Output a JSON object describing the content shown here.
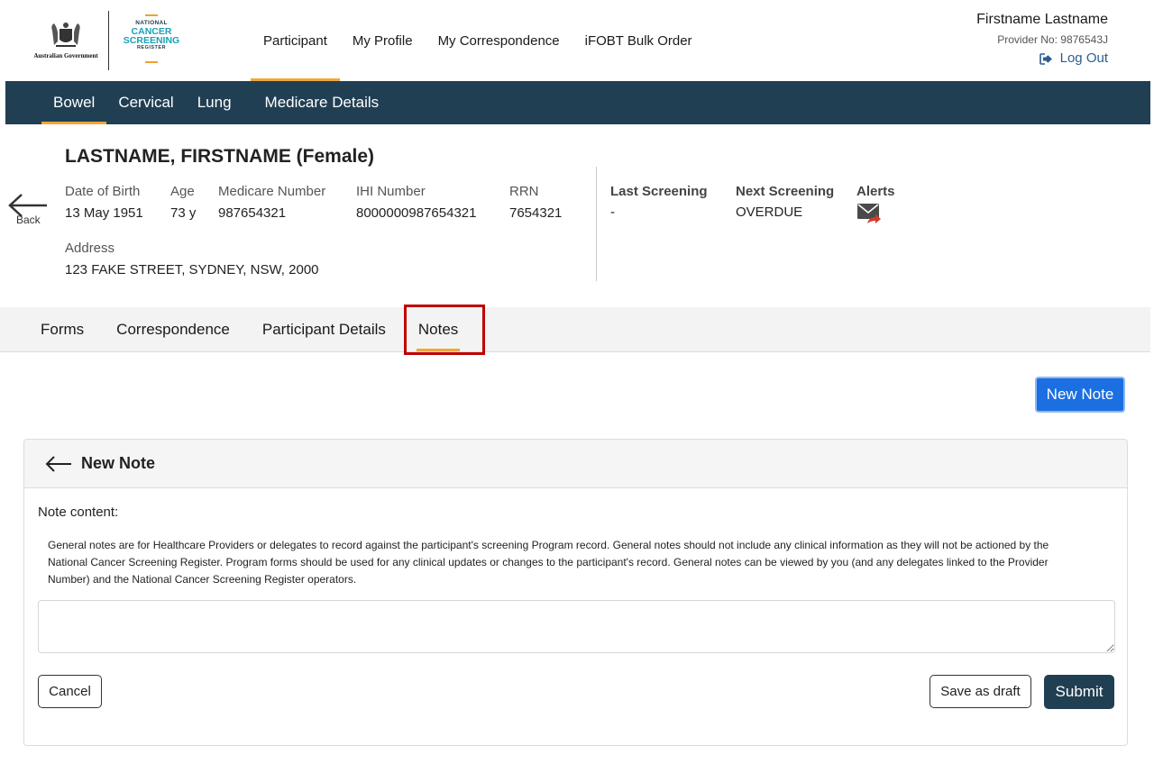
{
  "header": {
    "gov_logo_text": "Australian Government",
    "ncsr_logo": {
      "line1": "NATIONAL",
      "line2": "CANCER",
      "line3": "SCREENING",
      "line4": "REGISTER"
    },
    "nav": [
      {
        "label": "Participant",
        "active": true
      },
      {
        "label": "My Profile"
      },
      {
        "label": "My Correspondence"
      },
      {
        "label": "iFOBT Bulk Order"
      }
    ],
    "user": {
      "name": "Firstname Lastname",
      "provider_no": "Provider No: 9876543J",
      "logout_label": "Log Out"
    }
  },
  "subnav": [
    {
      "label": "Bowel",
      "active": true
    },
    {
      "label": "Cervical"
    },
    {
      "label": "Lung"
    },
    {
      "label": "Medicare Details"
    }
  ],
  "participant": {
    "back_label": "Back",
    "name": "LASTNAME, FIRSTNAME (Female)",
    "dob_label": "Date of Birth",
    "dob": "13 May 1951",
    "age_label": "Age",
    "age": "73 y",
    "medicare_label": "Medicare Number",
    "medicare": "987654321",
    "ihi_label": "IHI Number",
    "ihi": "8000000987654321",
    "rrn_label": "RRN",
    "rrn": "7654321",
    "address_label": "Address",
    "address": "123 FAKE STREET, SYDNEY, NSW, 2000",
    "last_screening_label": "Last Screening",
    "last_screening": "-",
    "next_screening_label": "Next Screening",
    "next_screening": "OVERDUE",
    "alerts_label": "Alerts"
  },
  "tabs": [
    {
      "label": "Forms"
    },
    {
      "label": "Correspondence"
    },
    {
      "label": "Participant Details"
    },
    {
      "label": "Notes",
      "active": true
    }
  ],
  "new_note_button": "New Note",
  "note_card": {
    "title": "New Note",
    "content_label": "Note content:",
    "description": "General notes are for Healthcare Providers or delegates to record against the participant's screening Program record. General notes should not include any clinical information as they will not be actioned by the National Cancer Screening Register. Program forms should be used for any clinical updates or changes to the participant's record. General notes can be viewed by you (and any delegates linked to the Provider Number) and the National Cancer Screening Register operators.",
    "textarea_value": "",
    "cancel_label": "Cancel",
    "save_draft_label": "Save as draft",
    "submit_label": "Submit"
  },
  "colors": {
    "nav_dark": "#213f53",
    "accent_orange": "#f2a53a",
    "primary_blue": "#1b6fe0",
    "highlight_red": "#c00000"
  }
}
